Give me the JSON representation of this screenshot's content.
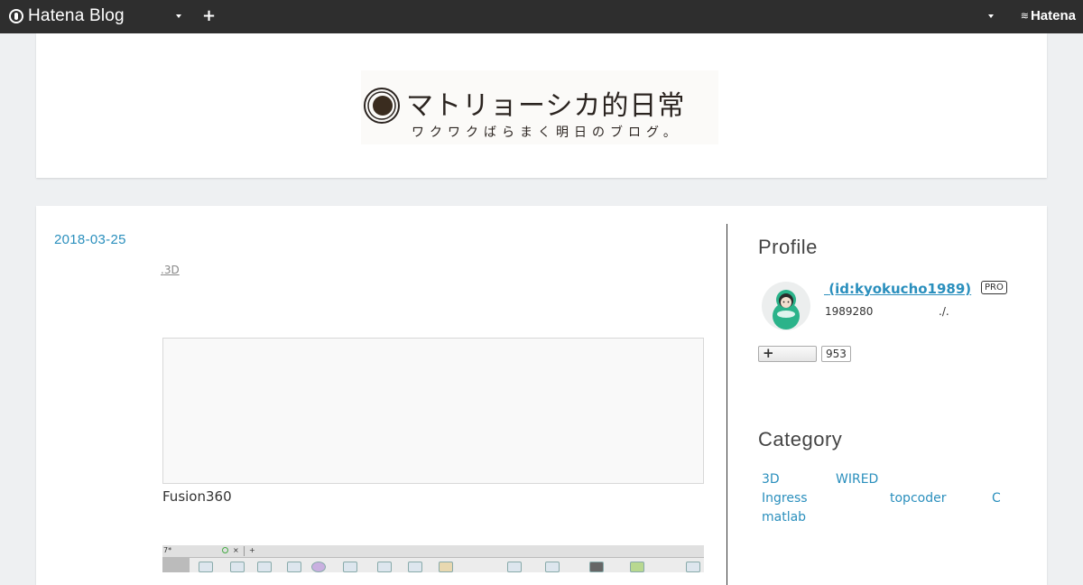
{
  "topbar": {
    "logo_text": "Hatena Blog",
    "add_label": "+",
    "brand": "Hatena"
  },
  "header": {
    "banner_title": "マトリョーシカ的日常",
    "banner_subtitle": "ワクワクばらまく明日のブログ。"
  },
  "entry": {
    "date": "2018-03-25",
    "category_link": "3D",
    "body_text": "Fusion360"
  },
  "screenshot": {
    "tab_label": "7*",
    "tab_close": "×",
    "tab_add": "+"
  },
  "sidebar": {
    "profile_title": "Profile",
    "profile_id": "(id:kyokucho1989)",
    "pro_badge": "PRO",
    "profile_desc": "1989280",
    "profile_desc_suffix": "./.",
    "follow_count": "953",
    "category_title": "Category",
    "categories": [
      "3D",
      "WIRED",
      "Ingress",
      "topcoder",
      "C",
      "matlab"
    ]
  },
  "colors": {
    "link": "#2a8fbd",
    "topbar": "#2e2e2e",
    "background": "#eef0f2"
  }
}
